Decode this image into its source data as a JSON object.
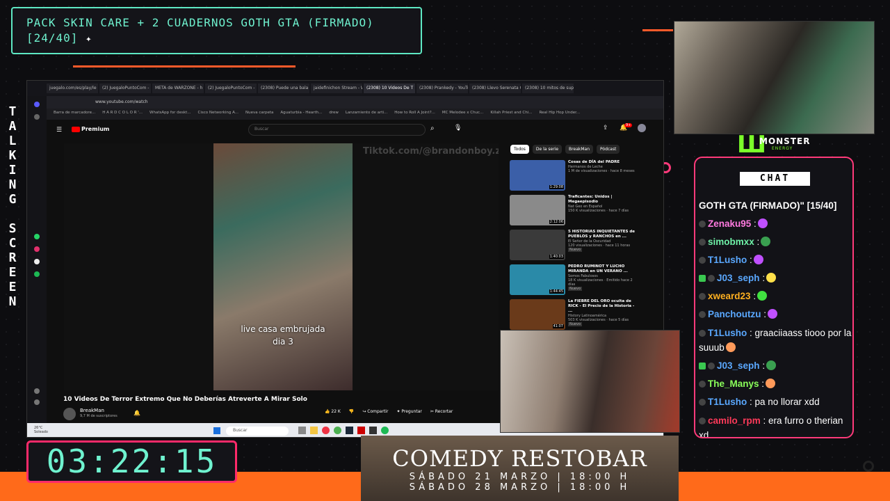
{
  "goal": {
    "line1": "PACK SKIN CARE + 2 CUADERNOS GOTH GTA (FIRMADO)",
    "line2": "[24/40]"
  },
  "side_text": "TALKING SCREEN",
  "timer": "03:22:15",
  "browser": {
    "tabs": [
      "juegalo.com/es/play/le",
      "(2) JuegaloPuntoCom -",
      "META de WARZONE - h",
      "(2) JuegaloPuntoCom -",
      "(2308) Puede una bala ",
      "jaidefinichon Stream - W",
      "(2308) 10 Videos De T",
      "(2308) Prankedy - YouTu",
      "(2308) Llevo Serenata Gr",
      "(2308) 10 mitos de supe"
    ],
    "active_tab": 6,
    "url": "www.youtube.com/watch",
    "bookmarks": [
      "Barra de marcadore...",
      "H A R D C O L O R '...",
      "WhatsApp for deskt...",
      "Cisco Networking A...",
      "Nueva carpeta",
      "Aguaturbia - Hearth...",
      "drew",
      "Lanzamiento de arti...",
      "How to Roll A Joint?...",
      "MC Melodee x Chuc...",
      "Killah Priest and Chi...",
      "Real Hip Hop Under..."
    ]
  },
  "youtube": {
    "logo_label": "Premium",
    "search_placeholder": "Buscar",
    "notif_count": "9+",
    "watermark": "Tiktok.com/@brandonboy.z",
    "caption_line1": "live casa embrujada",
    "caption_line2": "dia 3",
    "video_title": "10 Videos De Terror Extremo Que No Deberías Atreverte A Mirar Solo",
    "channel": "BreakMan",
    "subscribers": "9,7 M de suscriptores",
    "actions": [
      "22 K",
      "Compartir",
      "Preguntar",
      "Recortar"
    ],
    "chips": [
      "Todos",
      "De la serie",
      "BreakMan",
      "Pódcast"
    ],
    "recommended": [
      {
        "title": "Cosas de DÍA del PADRE",
        "channel": "Hermanos de Leche",
        "meta": "1 M de visualizaciones · hace 8 meses",
        "duration": "1:29:08",
        "color": "#3b5fa8"
      },
      {
        "title": "Traficantes: Unidos | Megaepisodio",
        "channel": "Nat Geo en Español",
        "meta": "150 K visualizaciones · hace 7 días",
        "duration": "2:12:06",
        "color": "#8a8a8a"
      },
      {
        "title": "5 HISTORIAS INQUIETANTES de PUEBLOS y RANCHOS en ...",
        "channel": "El Señor de la Oscuridad",
        "meta": "120 visualizaciones · hace 11 horas",
        "duration": "1:40:03",
        "badge": "Nuevo",
        "color": "#3a3a3a"
      },
      {
        "title": "PEDRO RUMINOT Y LUCHO MIRANDA en UN VERANO ...",
        "channel": "Somos Fabulosos",
        "meta": "18 K visualizaciones · Emitido hace 2 días",
        "duration": "1:44:45",
        "badge": "Nuevo",
        "color": "#2a8aa8"
      },
      {
        "title": "La FIEBRE DEL ORO oculta de RICK - El Precio de la Historia - ...",
        "channel": "History Latinoamérica",
        "meta": "503 K visualizaciones · hace 5 días",
        "duration": "41:07",
        "badge": "Nuevo",
        "color": "#6a3a1a"
      }
    ]
  },
  "taskbar": {
    "temp": "26°C",
    "weather": "Soleado",
    "search": "Buscar"
  },
  "monster": {
    "name": "MONSTER",
    "sub": "ENERGY"
  },
  "chat": {
    "title": "CHAT",
    "top_line": "GOTH GTA (FIRMADO)\" [15/40]",
    "messages": [
      {
        "user": "Zenaku95",
        "color": "#ff7ae0",
        "text": ":",
        "emote": "#c050ff"
      },
      {
        "user": "simobmxx",
        "color": "#6ff2a8",
        "text": ":",
        "emote": "#3aa050"
      },
      {
        "user": "T1Lusho",
        "color": "#5aa8ff",
        "text": ":",
        "emote": "#c050ff"
      },
      {
        "user": "J03_seph",
        "color": "#5aa8ff",
        "text": ":",
        "emote": "#ffe04a",
        "badges": 2
      },
      {
        "user": "xweard23",
        "color": "#ffb020",
        "text": ":",
        "emote": "#40e040",
        "badges": 1
      },
      {
        "user": "Panchoutzu",
        "color": "#5aa8ff",
        "text": ":",
        "emote": "#c050ff"
      },
      {
        "user": "T1Lusho",
        "color": "#5aa8ff",
        "text": ": graaciiaass tiooo por la suuub",
        "emote": "#ff9a5a",
        "wrap": true
      },
      {
        "user": "J03_seph",
        "color": "#5aa8ff",
        "text": ":",
        "emote": "#3aa050",
        "badges": 2
      },
      {
        "user": "The_Manys",
        "color": "#8aff5a",
        "text": ":",
        "emote": "#ff9a5a"
      },
      {
        "user": "T1Lusho",
        "color": "#5aa8ff",
        "text": ": pa no llorar xdd"
      },
      {
        "user": "camilo_rpm",
        "color": "#ff3a5a",
        "text": ": era furro o therian xd",
        "wrap": true
      }
    ]
  },
  "comedy": {
    "title": "COMEDY RESTOBAR",
    "date1": "SÁBADO 21 MARZO | 18:00 H",
    "date2": "SÁBADO 28 MARZO | 18:00 H"
  }
}
